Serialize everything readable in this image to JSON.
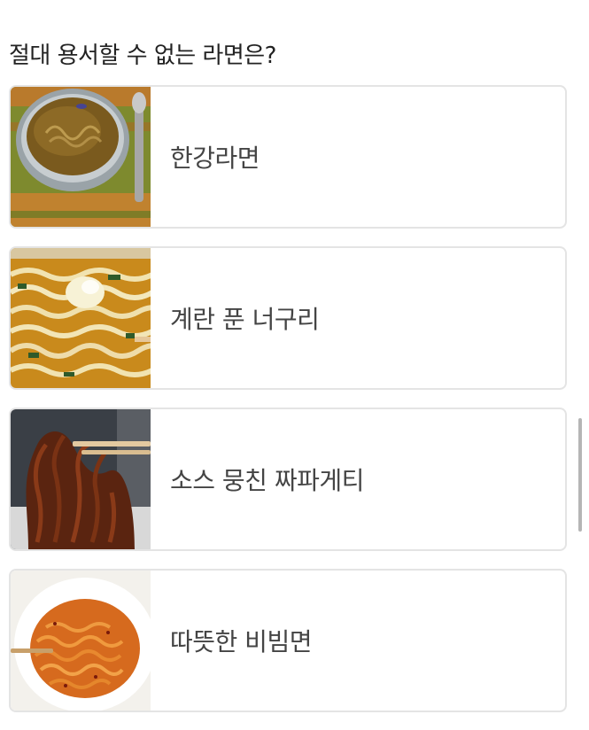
{
  "poll": {
    "question": "절대 용서할 수 없는 라면은?",
    "options": [
      {
        "label": "한강라면",
        "image": "ramen-bowl-broth-photo"
      },
      {
        "label": "계란 푼 너구리",
        "image": "egg-noodle-soup-photo"
      },
      {
        "label": "소스 뭉친 짜파게티",
        "image": "black-bean-noodles-chopsticks-photo"
      },
      {
        "label": "따뜻한 비빔면",
        "image": "spicy-noodles-bowl-photo"
      }
    ]
  },
  "colors": {
    "border": "#e4e4e4",
    "label": "#444444",
    "question": "#222222",
    "scrollbar": "#b5b5b5"
  }
}
